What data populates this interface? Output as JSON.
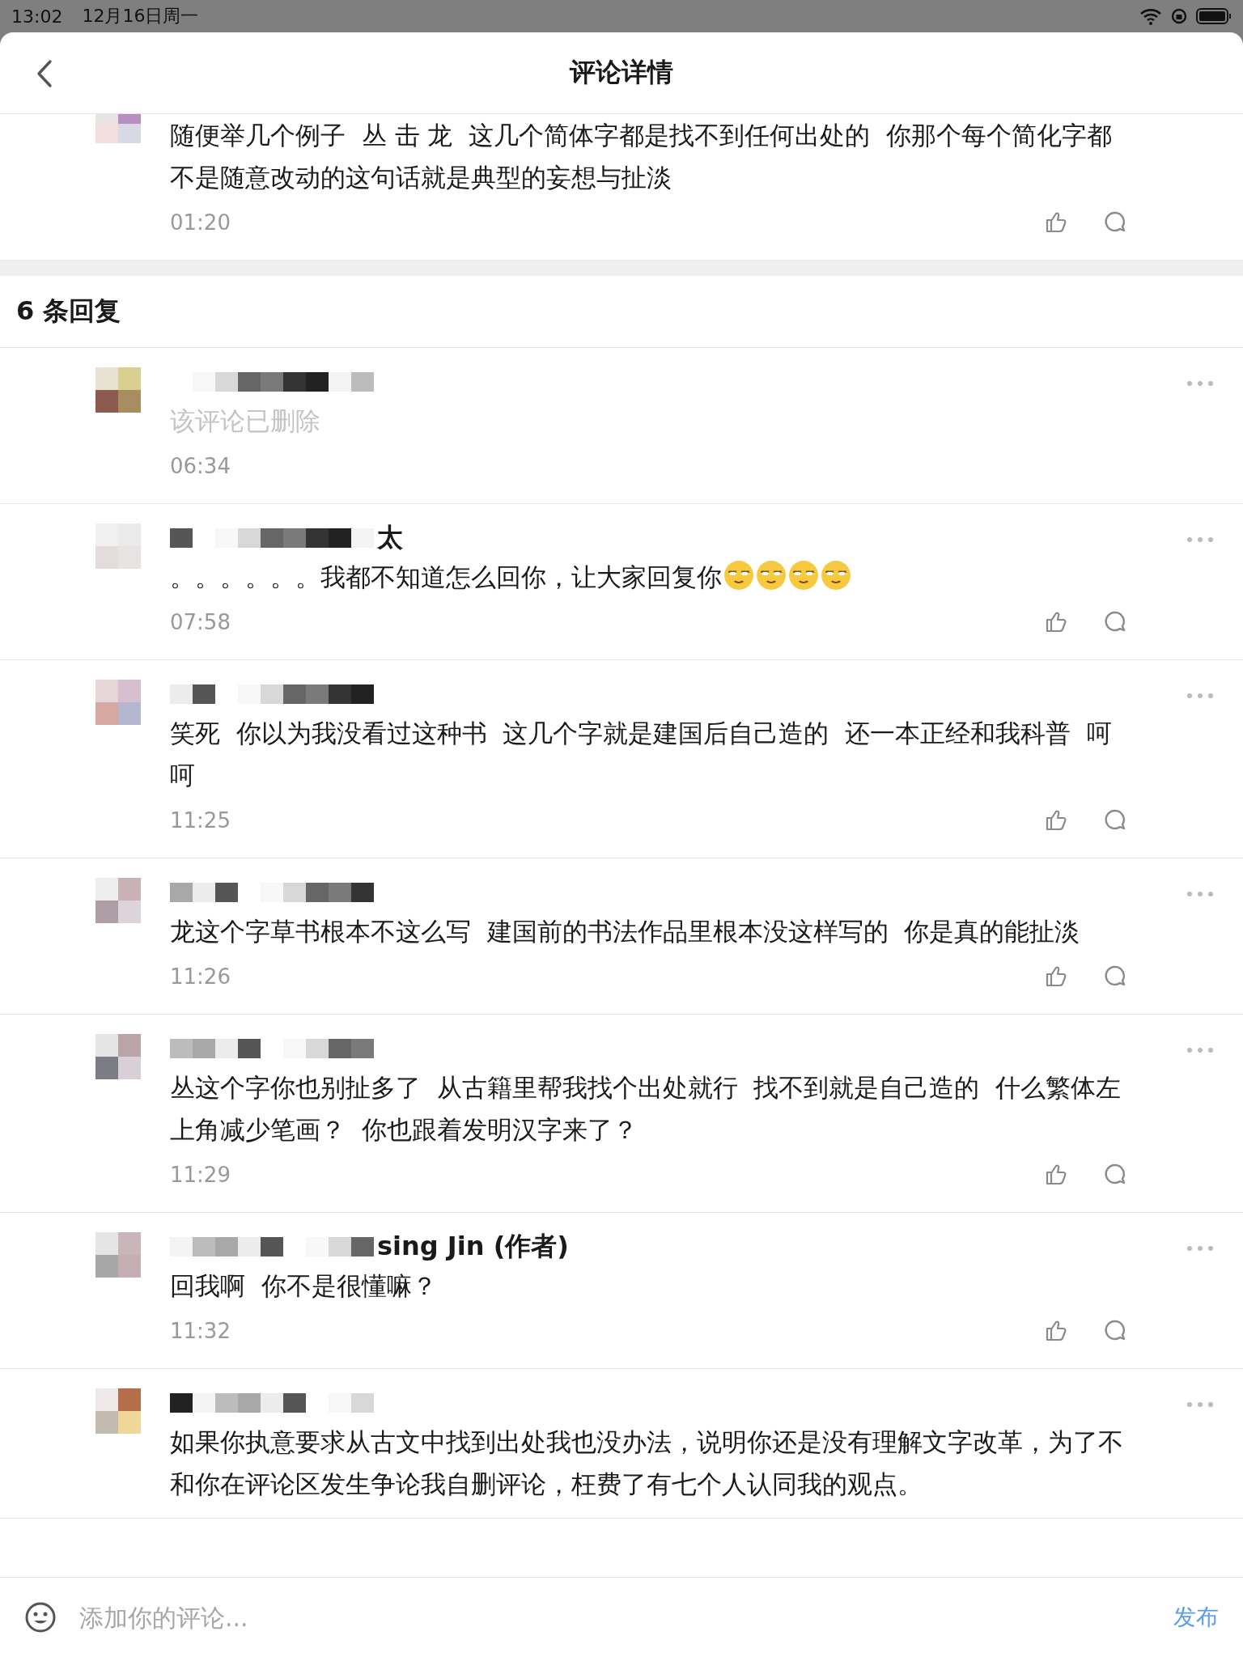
{
  "status_bar": {
    "time": "13:02",
    "date": "12月16日周一"
  },
  "header": {
    "title": "评论详情"
  },
  "main_comment": {
    "text": "随便举几个例子  丛 击 龙  这几个简体字都是找不到任何出处的  你那个每个简化字都不是随意改动的这句话就是典型的妄想与扯淡",
    "time": "01:20"
  },
  "replies_count": "6 条回复",
  "replies": [
    {
      "deleted": true,
      "text": "该评论已删除",
      "time": "06:34",
      "show_actions": false
    },
    {
      "author_visible": "太",
      "deleted": false,
      "text": "。。。。。。我都不知道怎么回你，让大家回复你",
      "emojis": [
        {
          "kind": "smug"
        },
        {
          "kind": "smug"
        },
        {
          "kind": "smug"
        },
        {
          "kind": "smug"
        }
      ],
      "time": "07:58",
      "show_actions": true
    },
    {
      "deleted": false,
      "text": "笑死  你以为我没看过这种书  这几个字就是建国后自己造的  还一本正经和我科普  呵呵",
      "time": "11:25",
      "show_actions": true
    },
    {
      "deleted": false,
      "text": "龙这个字草书根本不这么写  建国前的书法作品里根本没这样写的  你是真的能扯淡",
      "time": "11:26",
      "show_actions": true
    },
    {
      "deleted": false,
      "text": "丛这个字你也别扯多了  从古籍里帮我找个出处就行  找不到就是自己造的  什么繁体左上角减少笔画？  你也跟着发明汉字来了？",
      "time": "11:29",
      "show_actions": true
    },
    {
      "author_visible": "sing Jin (作者)",
      "deleted": false,
      "text": "回我啊  你不是很懂嘛？",
      "time": "11:32",
      "show_actions": true
    },
    {
      "deleted": false,
      "text": "如果你执意要求从古文中找到出处我也没办法，说明你还是没有理解文字改革，为了不和你在评论区发生争论我自删评论，枉费了有七个人认同我的观点。",
      "show_actions": false
    }
  ],
  "composer": {
    "placeholder": "添加你的评论...",
    "submit": "发布"
  }
}
